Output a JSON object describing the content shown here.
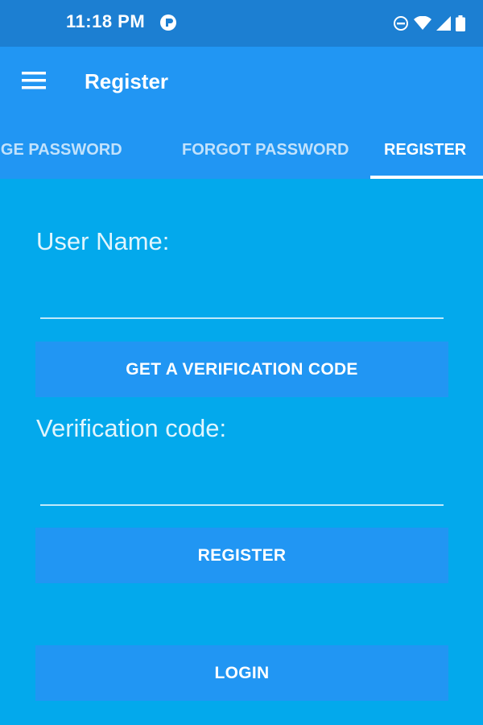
{
  "status_bar": {
    "time": "11:18 PM",
    "icons": [
      "app-notification-icon",
      "do-not-disturb-icon",
      "wifi-icon",
      "cell-signal-icon",
      "battery-icon"
    ]
  },
  "app_bar": {
    "menu_icon": "hamburger-menu-icon",
    "title": "Register",
    "tabs": [
      {
        "label": "ANGE PASSWORD",
        "active": false
      },
      {
        "label": "FORGOT PASSWORD",
        "active": false
      },
      {
        "label": "REGISTER",
        "active": true
      }
    ]
  },
  "form": {
    "username_label": "User Name:",
    "username_value": "",
    "verify_button": "GET A VERIFICATION CODE",
    "code_label": "Verification code:",
    "code_value": "",
    "register_button": "REGISTER",
    "login_button": "LOGIN"
  },
  "colors": {
    "status_bar": "#1C7FD2",
    "app_bar": "#2196F3",
    "background": "#03A9EC",
    "button": "#2196F3",
    "text": "#FFFFFF"
  }
}
